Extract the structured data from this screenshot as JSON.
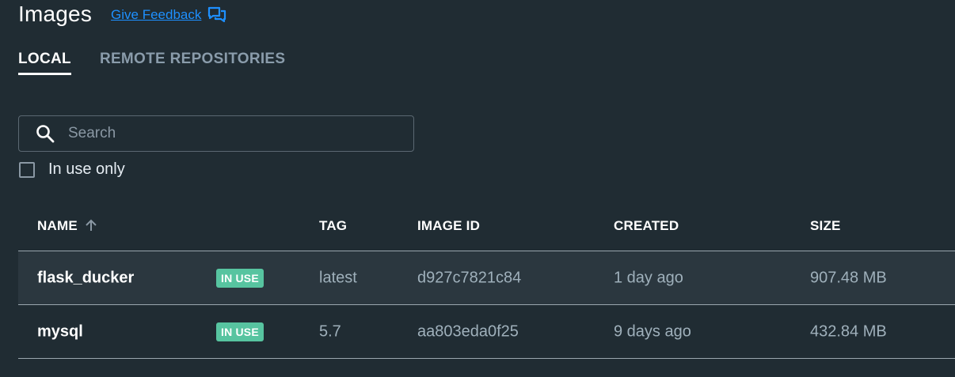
{
  "header": {
    "title": "Images",
    "feedback_label": "Give Feedback"
  },
  "tabs": [
    {
      "label": "LOCAL",
      "active": true
    },
    {
      "label": "REMOTE REPOSITORIES",
      "active": false
    }
  ],
  "search": {
    "placeholder": "Search",
    "value": ""
  },
  "filter": {
    "in_use_only_label": "In use only",
    "checked": false
  },
  "table": {
    "columns": {
      "name": "NAME",
      "tag": "TAG",
      "image_id": "IMAGE ID",
      "created": "CREATED",
      "size": "SIZE"
    },
    "sort": {
      "column": "NAME",
      "direction": "ascending"
    },
    "rows": [
      {
        "name": "flask_ducker",
        "badge": "IN USE",
        "tag": "latest",
        "image_id": "d927c7821c84",
        "created": "1 day ago",
        "size": "907.48 MB",
        "hovered": true
      },
      {
        "name": "mysql",
        "badge": "IN USE",
        "tag": "5.7",
        "image_id": "aa803eda0f25",
        "created": "9 days ago",
        "size": "432.84 MB",
        "hovered": false
      }
    ]
  },
  "colors": {
    "background": "#202c33",
    "accent_link": "#1e90ff",
    "badge": "#57c4a0",
    "row_hover": "#2b373f"
  },
  "icons": {
    "feedback": "chat-bubbles-icon",
    "search": "search-icon",
    "sort": "arrow-up-icon"
  }
}
